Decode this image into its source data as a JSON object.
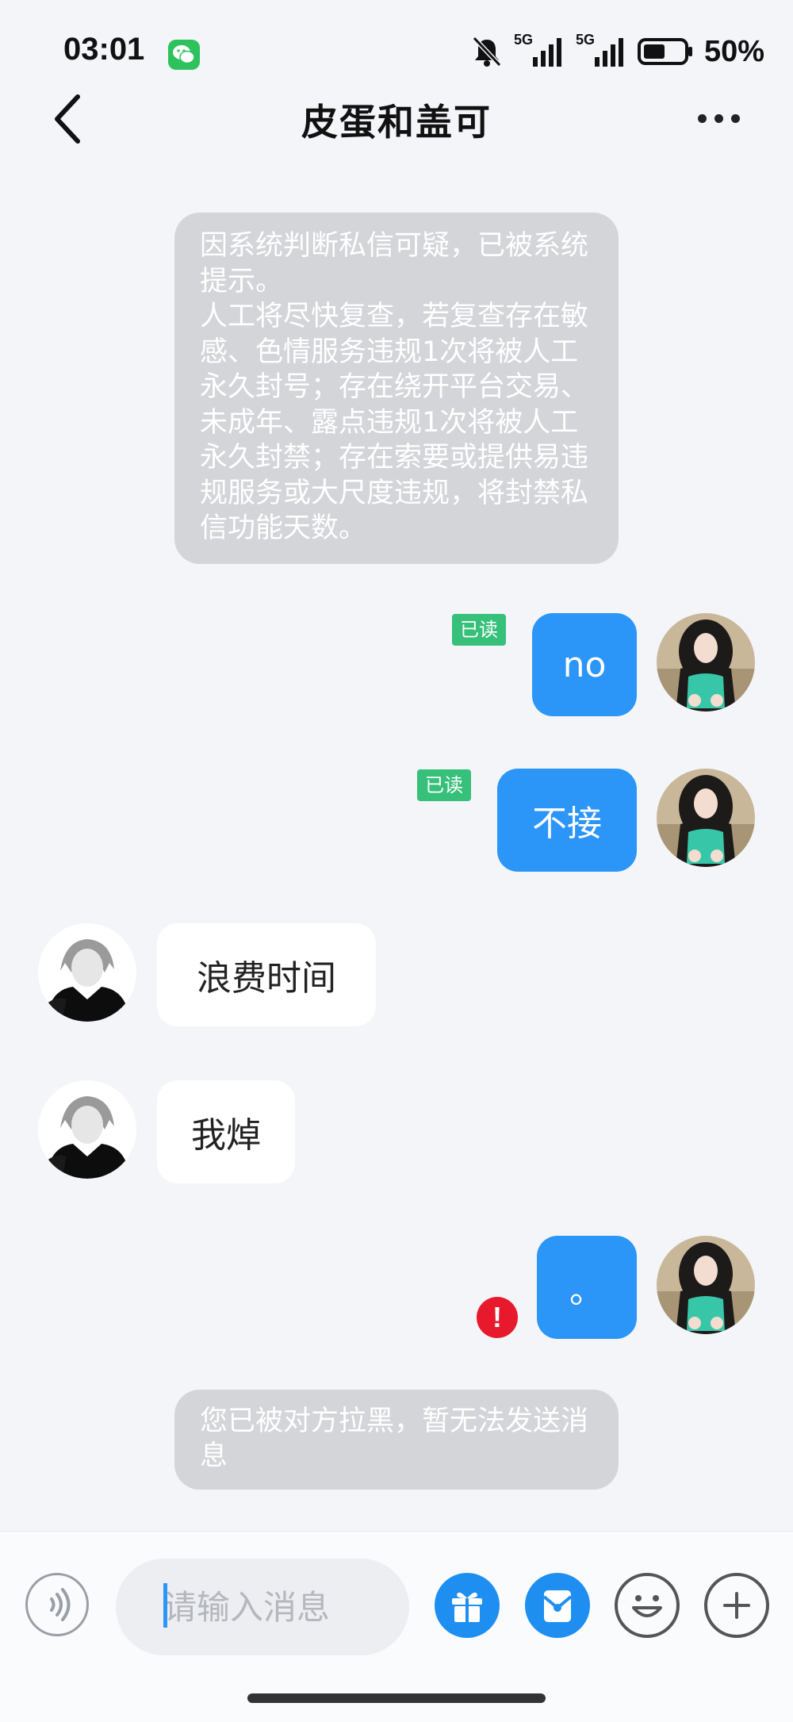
{
  "status_bar": {
    "time": "03:01",
    "network1": "5G",
    "network2": "5G",
    "battery": "50%"
  },
  "header": {
    "title": "皮蛋和盖可"
  },
  "system_notice": "因系统判断私信可疑，已被系统提示。\n人工将尽快复查，若复查存在敏感、色情服务违规1次将被人工永久封号；存在绕开平台交易、未成年、露点违规1次将被人工永久封禁；存在索要或提供易违规服务或大尺度违规，将封禁私信功能天数。",
  "messages": [
    {
      "direction": "out",
      "text": "no",
      "read": "已读"
    },
    {
      "direction": "out",
      "text": "不接",
      "read": "已读"
    },
    {
      "direction": "in",
      "text": "浪费时间"
    },
    {
      "direction": "in",
      "text": "我焯"
    },
    {
      "direction": "out",
      "text": "。",
      "error": "!"
    }
  ],
  "blocked_notice": "您已被对方拉黑，暂无法发送消息",
  "input": {
    "placeholder": "请输入消息"
  },
  "icons": {
    "back": "chevron-left-icon",
    "more": "more-dots-icon",
    "voice": "voice-icon",
    "gift": "gift-icon",
    "redpack": "red-packet-icon",
    "emoji": "emoji-icon",
    "plus": "plus-icon"
  },
  "colors": {
    "outgoing_bubble": "#2b95f8",
    "incoming_bubble": "#ffffff",
    "read_tag": "#36c07a",
    "error": "#e8192c",
    "notice": "#d3d5d9"
  }
}
